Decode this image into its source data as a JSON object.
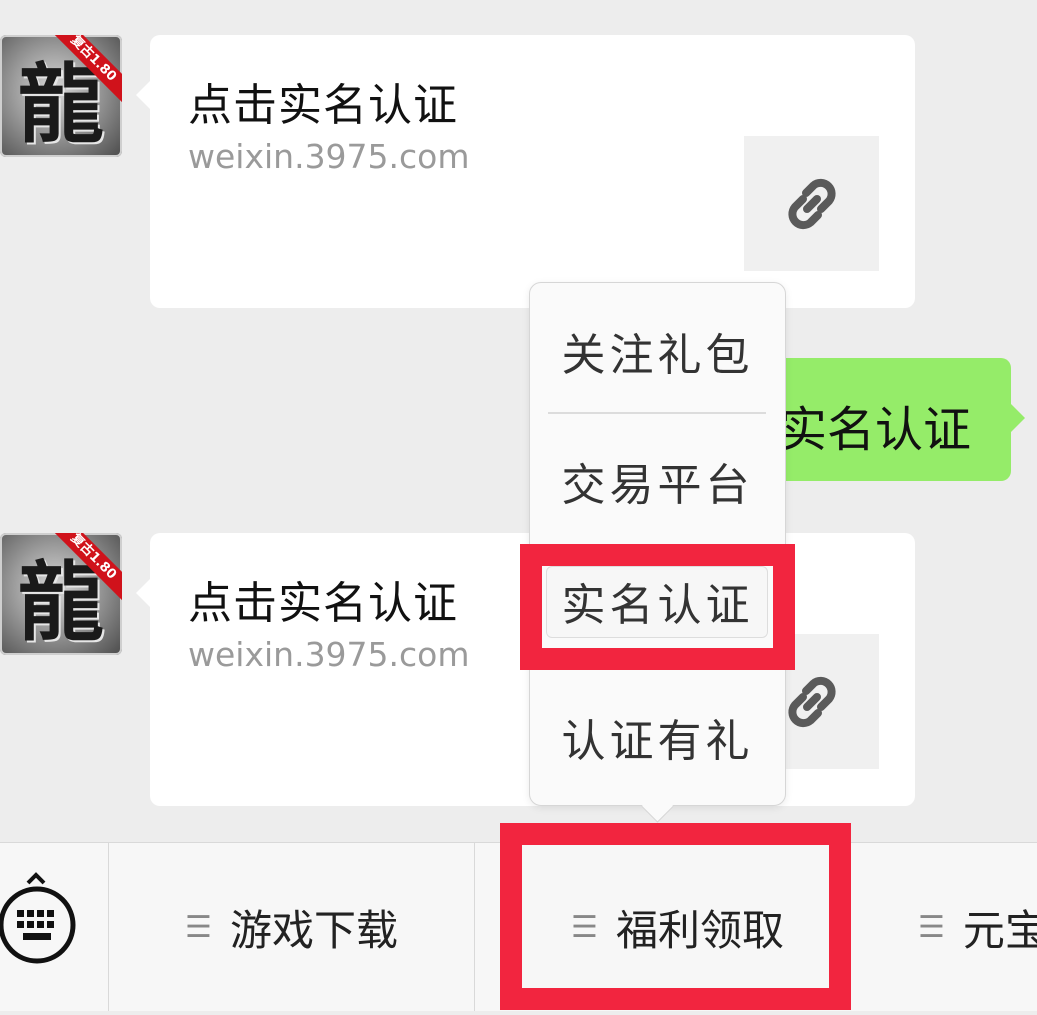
{
  "messages": [
    {
      "type": "link-card",
      "avatar": {
        "glyph": "龍",
        "ribbon": "复古1.80"
      },
      "title": "点击实名认证",
      "url": "weixin.3975.com",
      "icon": "link-icon"
    },
    {
      "type": "text",
      "sender": "self",
      "text": "实名认证"
    },
    {
      "type": "link-card",
      "avatar": {
        "glyph": "龍",
        "ribbon": "复古1.80"
      },
      "title": "点击实名认证",
      "url": "weixin.3975.com",
      "icon": "link-icon"
    }
  ],
  "submenu": {
    "items": [
      "关注礼包",
      "交易平台",
      "实名认证",
      "认证有礼"
    ],
    "highlighted": "实名认证"
  },
  "bottom_menu": {
    "keyboard_icon": "keyboard-icon",
    "items": [
      "游戏下载",
      "福利领取",
      "元宝"
    ],
    "active": "福利领取"
  },
  "colors": {
    "chat_background": "#ededed",
    "bubble_self": "#95ec69",
    "annotation_red": "#f2253f"
  }
}
